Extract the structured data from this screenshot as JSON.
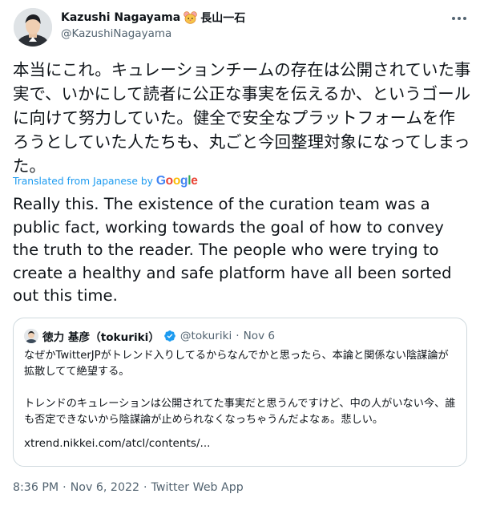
{
  "author": {
    "display_name": "Kazushi Nagayama",
    "name_suffix": "長山一石",
    "handle": "@KazushiNagayama"
  },
  "tweet": {
    "text_ja": "本当にこれ。キュレーションチームの存在は公開されていた事実で、いかにして読者に公正な事実を伝えるか、というゴールに向けて努力していた。健全で安全なプラットフォームを作ろうとしていた人たちも、丸ごと今回整理対象になってしまった。",
    "translated_label": "Translated from Japanese by",
    "translator": "Google",
    "text_en": "Really this. The existence of the curation team was a public fact, working towards the goal of how to convey the truth to the reader. The people who were trying to create a healthy and safe platform have all been sorted out this time."
  },
  "quoted": {
    "display_name": "徳力 基彦（tokuriki）",
    "handle": "@tokuriki",
    "separator": "·",
    "date": "Nov 6",
    "paragraph_1": "なぜかTwitterJPがトレンド入りしてるからなんでかと思ったら、本論と関係ない陰謀論が拡散してて絶望する。",
    "paragraph_2": "トレンドのキュレーションは公開されてた事実だと思うんですけど、中の人がいない今、誰も否定できないから陰謀論が止められなくなっちゃうんだよなぁ。悲しい。",
    "link": "xtrend.nikkei.com/atcl/contents/..."
  },
  "footer": {
    "time": "8:36 PM",
    "separator": "·",
    "date": "Nov 6, 2022",
    "source": "Twitter Web App"
  },
  "colors": {
    "accent": "#1d9bf0",
    "text": "#0f1419",
    "secondary": "#536471",
    "border": "#cfd9de"
  },
  "icons": {
    "more": "more-dots-icon",
    "verified": "verified-badge-icon",
    "emoji": "mouse-face-emoji-icon"
  }
}
